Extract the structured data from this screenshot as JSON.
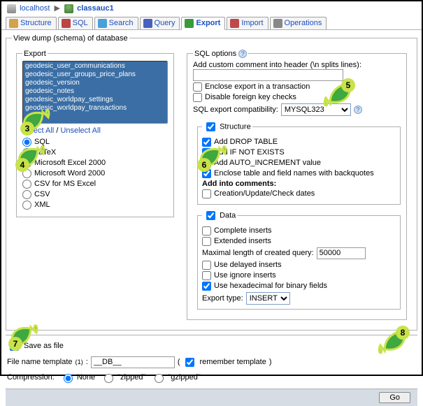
{
  "breadcrumb": {
    "server_label": "localhost",
    "db_label": "classauc1"
  },
  "tabs": {
    "structure": "Structure",
    "sql": "SQL",
    "search": "Search",
    "query": "Query",
    "export": "Export",
    "import": "Import",
    "ops": "Operations"
  },
  "view_legend": "View dump (schema) of database",
  "export": {
    "legend": "Export",
    "tables": [
      "geodesic_user_communications",
      "geodesic_user_groups_price_plans",
      "geodesic_version",
      "geodesic_notes",
      "geodesic_worldpay_settings",
      "geodesic_worldpay_transactions"
    ],
    "select_all": "Select All",
    "unselect_all": "Unselect All",
    "fmt": {
      "sql": "SQL",
      "latex": "LaTeX",
      "xls": "Microsoft Excel 2000",
      "word": "Microsoft Word 2000",
      "csvms": "CSV for MS Excel",
      "csv": "CSV",
      "xml": "XML"
    }
  },
  "sqlopts": {
    "legend": "SQL options",
    "add_comment_label": "Add custom comment into header (\\n splits lines):",
    "enclose": "Enclose export in a transaction",
    "disable_fk": "Disable foreign key checks",
    "compat_label": "SQL export compatibility:",
    "compat_value": "MYSQL323",
    "structure": {
      "legend": "Structure",
      "drop": "Add DROP TABLE",
      "ifnot": "Add IF NOT EXISTS",
      "autoinc": "Add AUTO_INCREMENT value",
      "backquotes": "Enclose table and field names with backquotes",
      "into_comments": "Add into comments:",
      "creation": "Creation/Update/Check dates"
    },
    "data": {
      "legend": "Data",
      "complete": "Complete inserts",
      "extended": "Extended inserts",
      "maxlen_label": "Maximal length of created query:",
      "maxlen_value": "50000",
      "delayed": "Use delayed inserts",
      "ignore": "Use ignore inserts",
      "hex": "Use hexadecimal for binary fields",
      "exptype_label": "Export type:",
      "exptype_value": "INSERT"
    }
  },
  "save": {
    "as_file": "Save as file",
    "template_label": "File name template",
    "sup": "(1)",
    "template_value": "__DB__",
    "remember": "remember template",
    "compression_label": "Compression:",
    "none": "None",
    "zipped": "\"zipped\"",
    "gzipped": "\"gzipped\""
  },
  "go": "Go",
  "markers": {
    "m3": "3",
    "m4": "4",
    "m5": "5",
    "m6": "6",
    "m7": "7",
    "m8": "8"
  }
}
